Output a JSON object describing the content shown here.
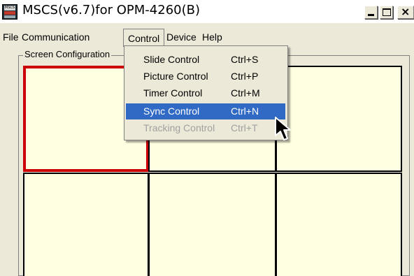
{
  "window": {
    "title": "MSCS(v6.7)for OPM-4260(B)",
    "icon_text": "MSCS",
    "controls": [
      "minimize-icon",
      "maximize-icon",
      "close-icon"
    ],
    "close_glyph": "×"
  },
  "menubar": {
    "file": "File",
    "communication": "Communication",
    "control": "Control",
    "device": "Device",
    "help": "Help"
  },
  "group": {
    "title": "Screen Configuration"
  },
  "grid": {
    "cells": 6,
    "selected_index": 0,
    "cell_color": "#ffffe1",
    "selected_border": "#cc0000"
  },
  "control_menu": {
    "items": [
      {
        "label": "Slide Control",
        "shortcut": "Ctrl+S",
        "state": "normal"
      },
      {
        "label": "Picture Control",
        "shortcut": "Ctrl+P",
        "state": "normal"
      },
      {
        "label": "Timer Control",
        "shortcut": "Ctrl+M",
        "state": "normal"
      },
      {
        "label": "Sync Control",
        "shortcut": "Ctrl+N",
        "state": "highlighted"
      },
      {
        "label": "Tracking Control",
        "shortcut": "Ctrl+T",
        "state": "disabled"
      }
    ],
    "highlight_color": "#316ac5"
  }
}
